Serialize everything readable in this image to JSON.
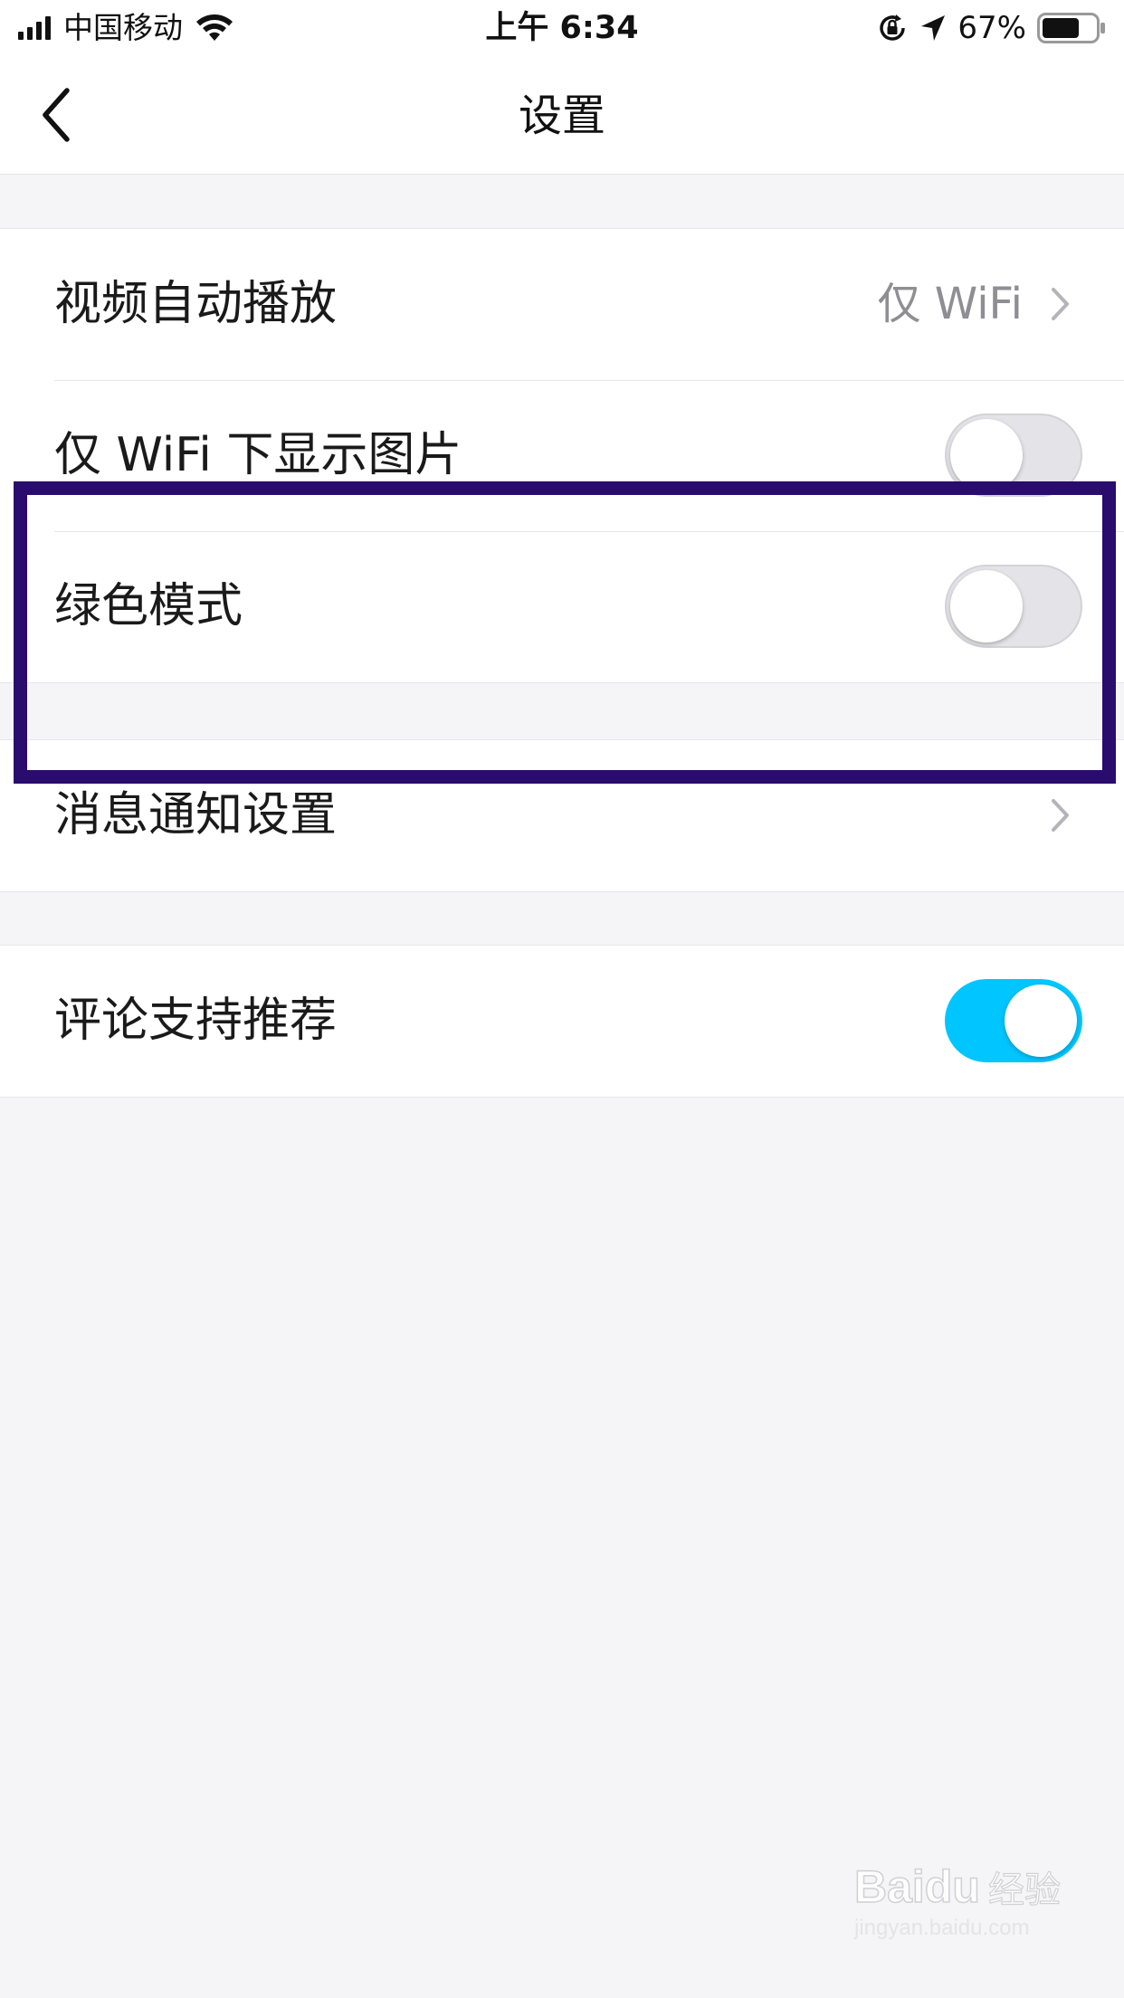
{
  "status_bar": {
    "carrier": "中国移动",
    "time": "上午 6:34",
    "battery": "67%"
  },
  "nav": {
    "title": "设置"
  },
  "groups": [
    {
      "rows": [
        {
          "label": "视频自动播放",
          "value": "仅 WiFi",
          "control": "chevron"
        },
        {
          "label": "仅 WiFi 下显示图片",
          "control": "toggle",
          "on": false
        },
        {
          "label": "绿色模式",
          "control": "toggle",
          "on": false
        }
      ]
    },
    {
      "rows": [
        {
          "label": "消息通知设置",
          "control": "chevron"
        }
      ]
    },
    {
      "rows": [
        {
          "label": "评论支持推荐",
          "control": "toggle",
          "on": true
        }
      ]
    }
  ],
  "watermark": {
    "brand": "Baidu",
    "cn": "经验",
    "url": "jingyan.baidu.com"
  },
  "colors": {
    "toggle_on": "#00c5ff",
    "highlight": "#2a0b6e",
    "background": "#f5f5f7"
  }
}
